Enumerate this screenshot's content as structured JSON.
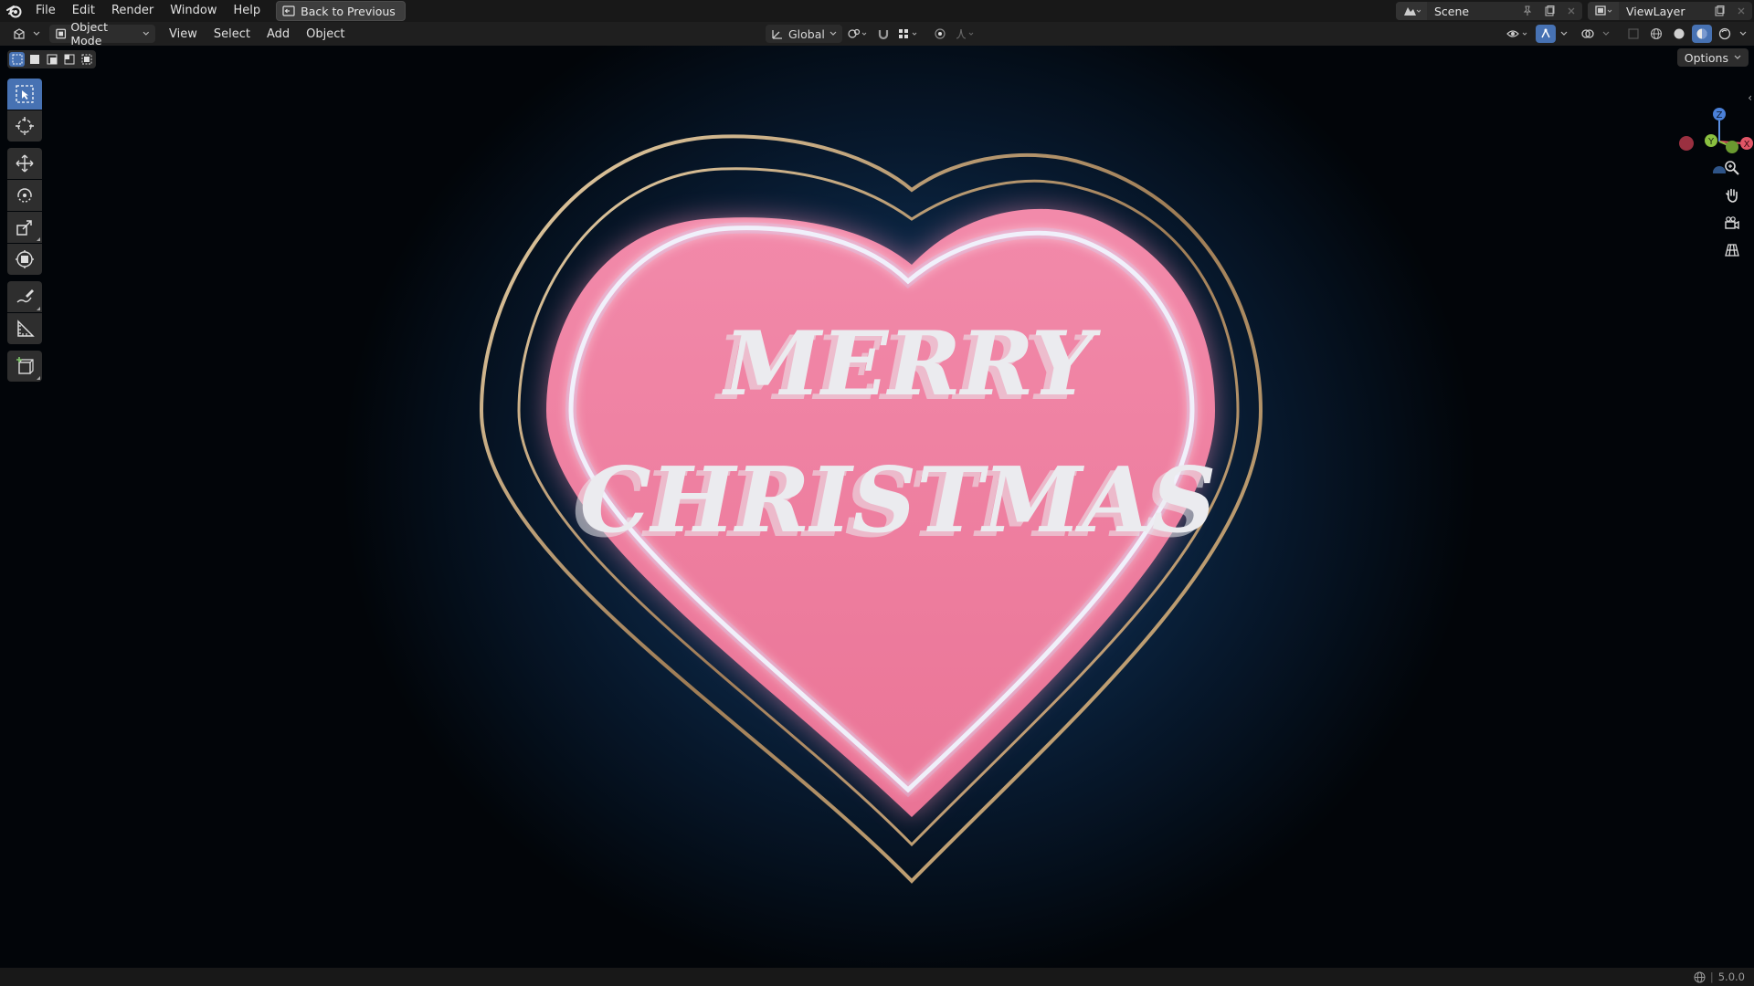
{
  "menu": {
    "items": [
      "File",
      "Edit",
      "Render",
      "Window",
      "Help"
    ],
    "back_button": "Back to Previous"
  },
  "workspace": {
    "scene_name": "Scene",
    "view_layer_name": "ViewLayer"
  },
  "header": {
    "mode": "Object Mode",
    "menus": [
      "View",
      "Select",
      "Add",
      "Object"
    ],
    "transform_orientation": "Global",
    "options_label": "Options"
  },
  "viewport": {
    "text_line1": "MERRY",
    "text_line2": "CHRISTMAS",
    "colors": {
      "heart_fill": "#ee7a9c",
      "ring_gold": "#c8a878",
      "glow": "#e8f0ff",
      "background": "#0d2b4c"
    }
  },
  "gizmo": {
    "z_label": "Z",
    "y_label": "Y",
    "x_label": "X"
  },
  "toolshelf": {
    "tools": [
      "select-box",
      "cursor",
      "move",
      "rotate",
      "scale",
      "transform",
      "annotate",
      "measure",
      "add-cube"
    ],
    "active": "select-box"
  },
  "statusbar": {
    "version": "5.0.0"
  },
  "accent_color": "#4772b3"
}
